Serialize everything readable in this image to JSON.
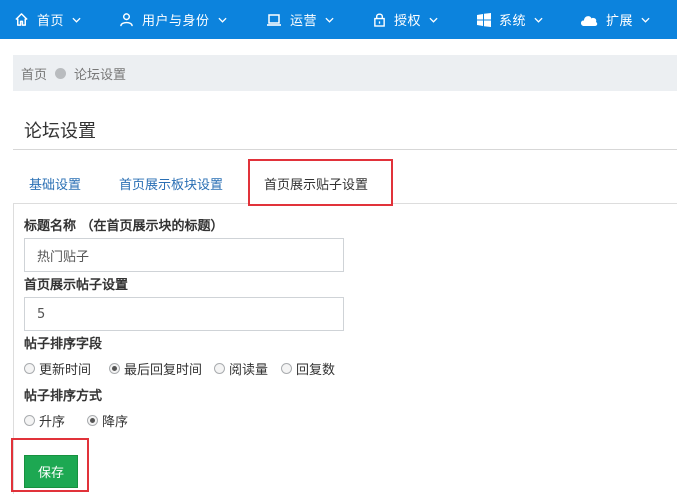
{
  "nav": {
    "items": [
      {
        "label": "首页",
        "icon": "home-icon"
      },
      {
        "label": "用户与身份",
        "icon": "user-icon"
      },
      {
        "label": "运营",
        "icon": "laptop-icon"
      },
      {
        "label": "授权",
        "icon": "lock-icon"
      },
      {
        "label": "系统",
        "icon": "windows-icon"
      },
      {
        "label": "扩展",
        "icon": "cloud-icon"
      }
    ]
  },
  "breadcrumb": {
    "home": "首页",
    "current": "论坛设置"
  },
  "page": {
    "title": "论坛设置"
  },
  "tabs": [
    {
      "label": "基础设置",
      "active": false
    },
    {
      "label": "首页展示板块设置",
      "active": false
    },
    {
      "label": "首页展示贴子设置",
      "active": true
    }
  ],
  "form": {
    "title_label": "标题名称 （在首页展示块的标题）",
    "title_value": "热门贴子",
    "count_label": "首页展示帖子设置",
    "count_value": "5",
    "sort_field_label": "帖子排序字段",
    "sort_field_options": [
      "更新时间",
      "最后回复时间",
      "阅读量",
      "回复数"
    ],
    "sort_field_selected": "最后回复时间",
    "sort_order_label": "帖子排序方式",
    "sort_order_options": [
      "升序",
      "降序"
    ],
    "sort_order_selected": "降序",
    "save_label": "保存"
  },
  "colors": {
    "nav_bg": "#0c83dd",
    "highlight_border": "#e1323a",
    "save_bg": "#1da852",
    "tab_link": "#2a6fb4"
  }
}
